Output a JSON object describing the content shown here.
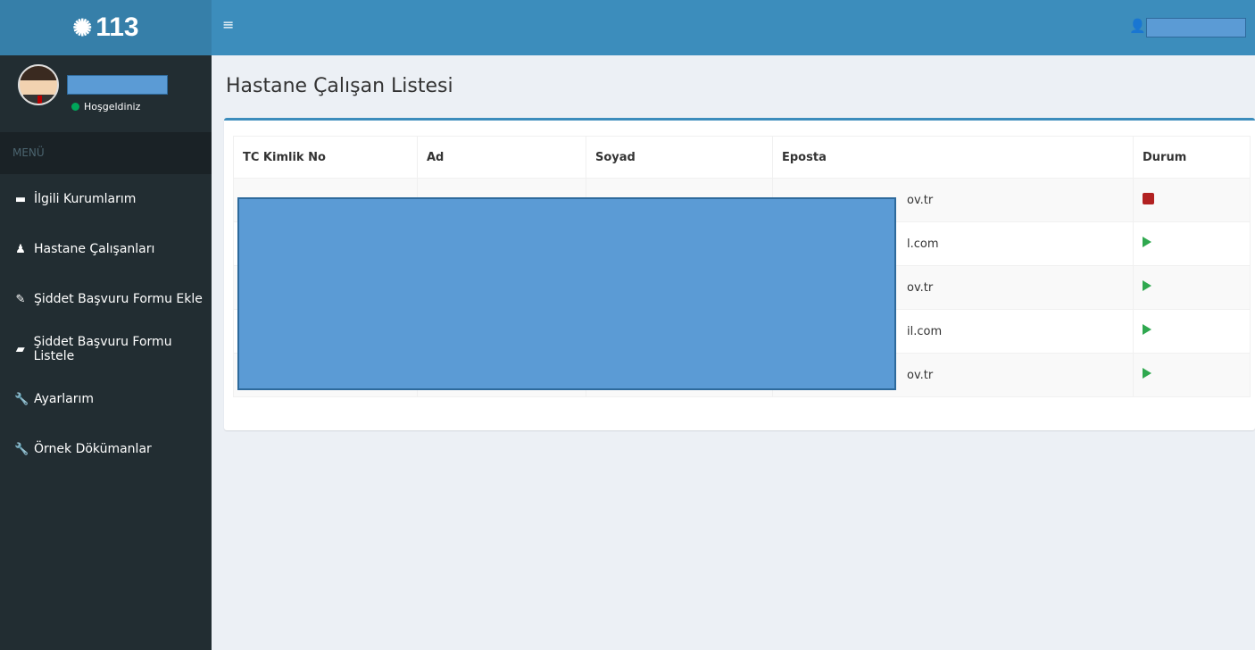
{
  "header": {
    "logo": "113",
    "user_name": ""
  },
  "sidebar": {
    "user_name": "",
    "status": "Hoşgeldiniz",
    "menu_header": "MENÜ",
    "items": [
      {
        "label": "İlgili Kurumlarım",
        "icon": "folder-icon"
      },
      {
        "label": "Hastane Çalışanları",
        "icon": "user-icon"
      },
      {
        "label": "Şiddet Başvuru Formu Ekle",
        "icon": "edit-icon"
      },
      {
        "label": "Şiddet Başvuru Formu Listele",
        "icon": "book-icon"
      },
      {
        "label": "Ayarlarım",
        "icon": "wrench-icon"
      },
      {
        "label": "Örnek Dökümanlar",
        "icon": "wrench-icon"
      }
    ]
  },
  "main": {
    "title": "Hastane Çalışan Listesi",
    "table": {
      "headers": [
        "TC Kimlik No",
        "Ad",
        "Soyad",
        "Eposta",
        "Durum"
      ],
      "rows": [
        {
          "tc": "",
          "ad": "",
          "soyad": "",
          "eposta": "ov.tr",
          "durum": "stop"
        },
        {
          "tc": "",
          "ad": "",
          "soyad": "",
          "eposta": "l.com",
          "durum": "play"
        },
        {
          "tc": "",
          "ad": "",
          "soyad": "",
          "eposta": "ov.tr",
          "durum": "play"
        },
        {
          "tc": "",
          "ad": "",
          "soyad": "",
          "eposta": "il.com",
          "durum": "play"
        },
        {
          "tc": "",
          "ad": "",
          "soyad": "",
          "eposta": "ov.tr",
          "durum": "play"
        }
      ]
    }
  },
  "colors": {
    "topbar": "#3c8dbc",
    "logo_bar": "#367fa9",
    "sidebar": "#222d32",
    "stop": "#b22222",
    "play": "#2fa84f",
    "redaction": "#5b9bd5"
  }
}
